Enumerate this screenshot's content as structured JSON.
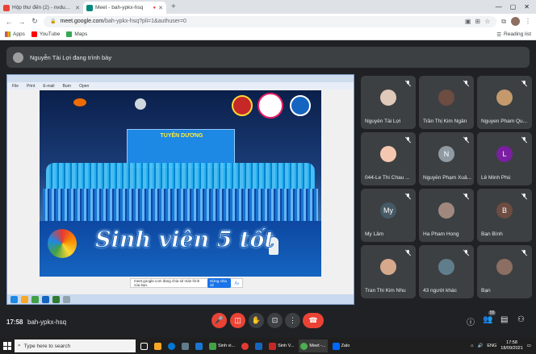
{
  "browser": {
    "tabs": [
      {
        "title": "Hộp thư đến (2) - nvduy-cntp1@..",
        "active": false,
        "color": "#ea4335"
      },
      {
        "title": "Meet - bah-ypkx-hsq",
        "active": true,
        "color": "#00897b"
      }
    ],
    "url_host": "meet.google.com",
    "url_path": "/bah-ypkx-hsq?pli=1&authuser=0",
    "bookmarks": [
      "Apps",
      "YouTube",
      "Maps"
    ],
    "reading_list": "Reading list"
  },
  "meet": {
    "presenter_text": "Nguyễn Tài Lợi đang trình bày",
    "share_notice": "meet.google.com đang chia sẻ màn hình của bạn.",
    "share_stop": "Dừng chia sẻ",
    "share_hide": "Ẩn",
    "slide_banner": "TUYÊN DƯƠNG",
    "slide_slogan": "Sinh viên 5 tốt",
    "viewer_menu": [
      "File",
      "Print",
      "E-mail",
      "Burn",
      "Open"
    ],
    "participants": [
      {
        "name": "Nguyễn Tài Lợi",
        "initial": "",
        "color": "#e0c9b8"
      },
      {
        "name": "Trần Thị Kim Ngân",
        "initial": "",
        "color": "#6d4c41"
      },
      {
        "name": "Nguyen Pham Qu...",
        "initial": "",
        "color": "#c49a6c"
      },
      {
        "name": "044-Le Thi Chau ...",
        "initial": "",
        "color": "#f4c7b0"
      },
      {
        "name": "Nguyễn Phạm Xuâ...",
        "initial": "N",
        "color": "#8f9aa3"
      },
      {
        "name": "Lê Minh Phú",
        "initial": "L",
        "color": "#7b1fa2"
      },
      {
        "name": "My Lâm",
        "initial": "My",
        "color": "#455a64"
      },
      {
        "name": "Ha Pham Hong",
        "initial": "",
        "color": "#a1887f"
      },
      {
        "name": "Bạn Bình",
        "initial": "B",
        "color": "#6d4c41"
      },
      {
        "name": "Tran Thi Kim Nhu",
        "initial": "",
        "color": "#d7a98c"
      },
      {
        "name": "43 người khác",
        "initial": "",
        "color": "#607d8b"
      },
      {
        "name": "Bạn",
        "initial": "",
        "color": "#8d6e63"
      }
    ],
    "time": "17:58",
    "meeting_code": "bah-ypkx-hsq",
    "participant_count": "55"
  },
  "taskbar": {
    "search_placeholder": "Type here to search",
    "apps": [
      "Sinh vi...",
      "Sinh V...",
      "Meet -...",
      "Zalo"
    ],
    "lang": "ENG",
    "time": "17:58",
    "date": "18/09/2021"
  }
}
